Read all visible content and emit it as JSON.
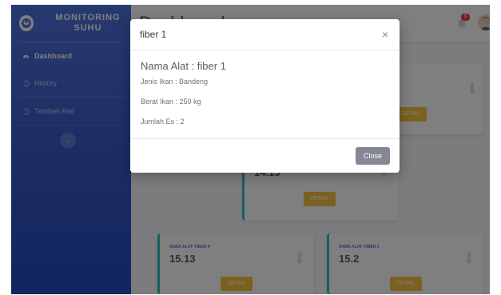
{
  "sidebar": {
    "brand": "MONITORING SUHU",
    "items": [
      {
        "label": "Dashboard",
        "icon": "dashboard-icon"
      },
      {
        "label": "History",
        "icon": "history-icon"
      },
      {
        "label": "Tambah Alat",
        "icon": "history-icon"
      }
    ],
    "toggle_icon": "chevron-left-icon"
  },
  "topbar": {
    "title": "Dashboard",
    "alerts_badge": "0",
    "user": "user-avatar"
  },
  "cards": [
    {
      "label": "",
      "value": "",
      "button": "DETAIL"
    },
    {
      "label": "",
      "value": "14.13",
      "button": "DETAIL"
    },
    {
      "label": "NAMA ALAT: FIBER 4",
      "value": "15.13",
      "button": "DETAIL"
    },
    {
      "label": "NAMA ALAT: FIBER 5",
      "value": "15.2",
      "button": "DETAIL"
    }
  ],
  "modal": {
    "title": "fiber 1",
    "heading": "Nama Alat : fiber 1",
    "lines": [
      "Jenis Ikan : Bandeng",
      "Berat Ikan : 250 kg",
      "Jumlah Es : 2"
    ],
    "close_label": "Close",
    "close_icon": "×"
  },
  "colors": {
    "primary": "#4e73df",
    "warning": "#f6c23e",
    "info": "#36b9cc",
    "secondary": "#858796",
    "danger": "#e74a3b"
  }
}
